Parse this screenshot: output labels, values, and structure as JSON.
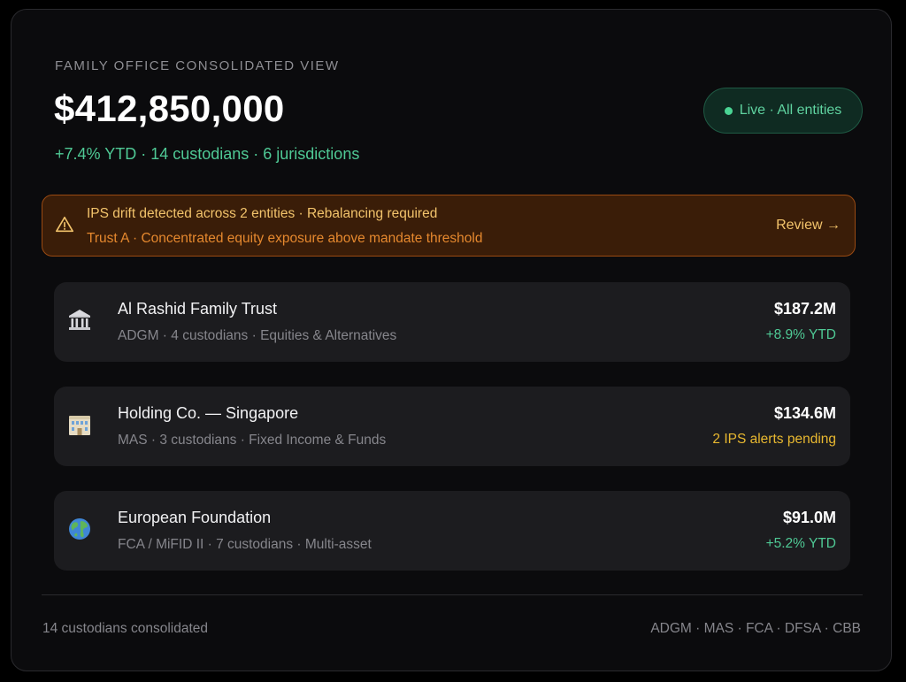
{
  "header": {
    "eyebrow": "FAMILY OFFICE CONSOLIDATED VIEW",
    "total": "$412,850,000",
    "subline": "+7.4% YTD · 14 custodians · 6 jurisdictions",
    "live_label": "Live · All entities"
  },
  "alert": {
    "icon": "warning-triangle-icon",
    "title": "IPS drift detected across 2 entities · Rebalancing required",
    "detail": "Trust A · Concentrated equity exposure above mandate threshold",
    "action": "Review →"
  },
  "entities": [
    {
      "icon": "bank-building-icon",
      "name": "Al Rashid Family Trust",
      "meta": "ADGM · 4 custodians · Equities & Alternatives",
      "value": "$187.2M",
      "change": "+8.9% YTD",
      "change_color": "#4fc995"
    },
    {
      "icon": "office-building-icon",
      "name": "Holding Co. — Singapore",
      "meta": "MAS · 3 custodians · Fixed Income & Funds",
      "value": "$134.6M",
      "change": "2 IPS alerts pending",
      "change_color": "#e8b830"
    },
    {
      "icon": "globe-icon",
      "name": "European Foundation",
      "meta": "FCA / MiFID II · 7 custodians · Multi-asset",
      "value": "$91.0M",
      "change": "+5.2% YTD",
      "change_color": "#4fc995"
    }
  ],
  "footer": {
    "left": "14 custodians consolidated",
    "right": "ADGM · MAS · FCA · DFSA · CBB"
  },
  "colors": {
    "positive": "#4fc995",
    "warning": "#e8b830",
    "alert_bg": "#3a1d08",
    "live_green": "#5fd3a0"
  }
}
